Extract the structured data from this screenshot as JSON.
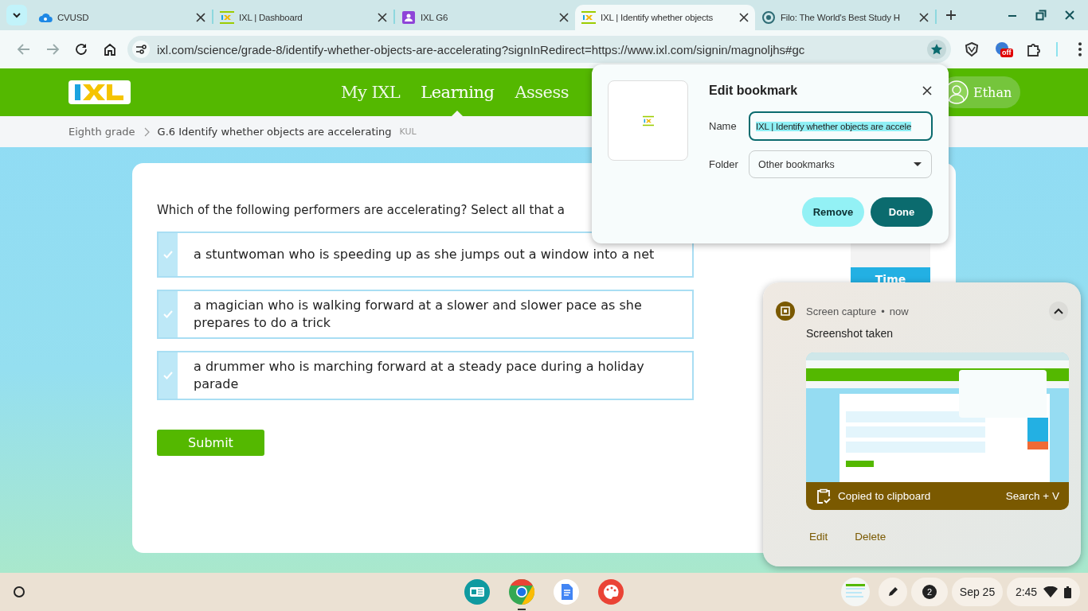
{
  "tab_strip": {
    "tabs": [
      {
        "title": "CVUSD",
        "selected": false
      },
      {
        "title": "IXL | Dashboard",
        "selected": false
      },
      {
        "title": "IXL G6",
        "selected": false
      },
      {
        "title": "IXL | Identify whether objects",
        "selected": true
      },
      {
        "title": "Filo: The World's Best Study H",
        "selected": false
      }
    ]
  },
  "address_bar": {
    "url": "ixl.com/science/grade-8/identify-whether-objects-are-accelerating?signInRedirect=https://www.ixl.com/signin/magnoljhs#gc",
    "bookmarked": true,
    "extension_badge": "off"
  },
  "site_header": {
    "nav": [
      {
        "label": "My IXL",
        "selected": false
      },
      {
        "label": "Learning",
        "selected": true
      },
      {
        "label": "Assess",
        "selected": false
      }
    ],
    "user": "Ethan"
  },
  "breadcrumb": {
    "items": [
      "Eighth grade",
      "G.6 Identify whether objects are accelerating"
    ],
    "code": "KUL"
  },
  "question": {
    "prompt": "Which of the following performers are accelerating? Select all that a",
    "choices": [
      {
        "text": "a stuntwoman who is speeding up as she jumps out a window into a net",
        "selected": false
      },
      {
        "text": "a magician who is walking forward at a slower and slower pace as she prepares to do a trick",
        "selected": false
      },
      {
        "text": "a drummer who is marching forward at a steady pace during a holiday parade",
        "selected": false
      }
    ],
    "submit": "Submit"
  },
  "side_panel": {
    "timer_label": "Time"
  },
  "bookmark_dialog": {
    "title": "Edit bookmark",
    "name_label": "Name",
    "name_value": "IXL | Identify whether objects are accele",
    "name_selected": true,
    "folder_label": "Folder",
    "folder_value": "Other bookmarks",
    "buttons": [
      {
        "label": "Remove",
        "kind": "secondary"
      },
      {
        "label": "Done",
        "kind": "primary"
      }
    ]
  },
  "notification": {
    "source": "Screen capture",
    "separator": "•",
    "time": "now",
    "title": "Screenshot taken",
    "expanded": true,
    "preview": {
      "kind": "picture"
    },
    "banner": "Copied to clipboard",
    "shortcut": "Search + V",
    "actions": [
      "Edit",
      "Delete"
    ]
  },
  "shelf": {
    "apps": [
      {
        "running": false
      },
      {
        "running": true
      },
      {
        "running": false
      },
      {
        "running": false
      }
    ],
    "notification_count": "2",
    "date": "Sep 25",
    "time": "2:45"
  }
}
